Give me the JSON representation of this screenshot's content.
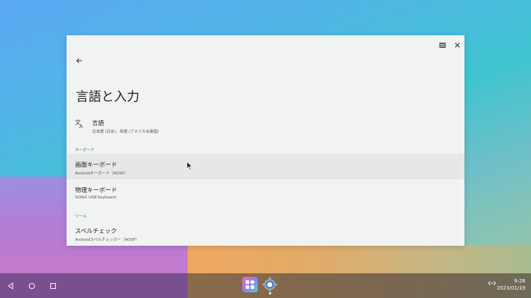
{
  "window": {
    "title": "言語と入力"
  },
  "language": {
    "title": "言語",
    "subtitle": "日本語 (日本)、英語 (アメリカ合衆国)"
  },
  "sections": {
    "keyboard": "キーボード",
    "tools": "ツール"
  },
  "rows": [
    {
      "title": "画面キーボード",
      "subtitle": "Androidキーボード（AOSP）"
    },
    {
      "title": "物理キーボード",
      "subtitle": "SONiX USB Keyboard"
    },
    {
      "title": "スペルチェック",
      "subtitle": "Androidスペルチェッカー（AOSP）"
    }
  ],
  "taskbar": {
    "time": "9:28",
    "date": "2023/01/19"
  },
  "colors": {
    "window_bg": "#f1f3f2",
    "section_label": "#3b6e8f",
    "active_row": "#e6e8e7"
  }
}
